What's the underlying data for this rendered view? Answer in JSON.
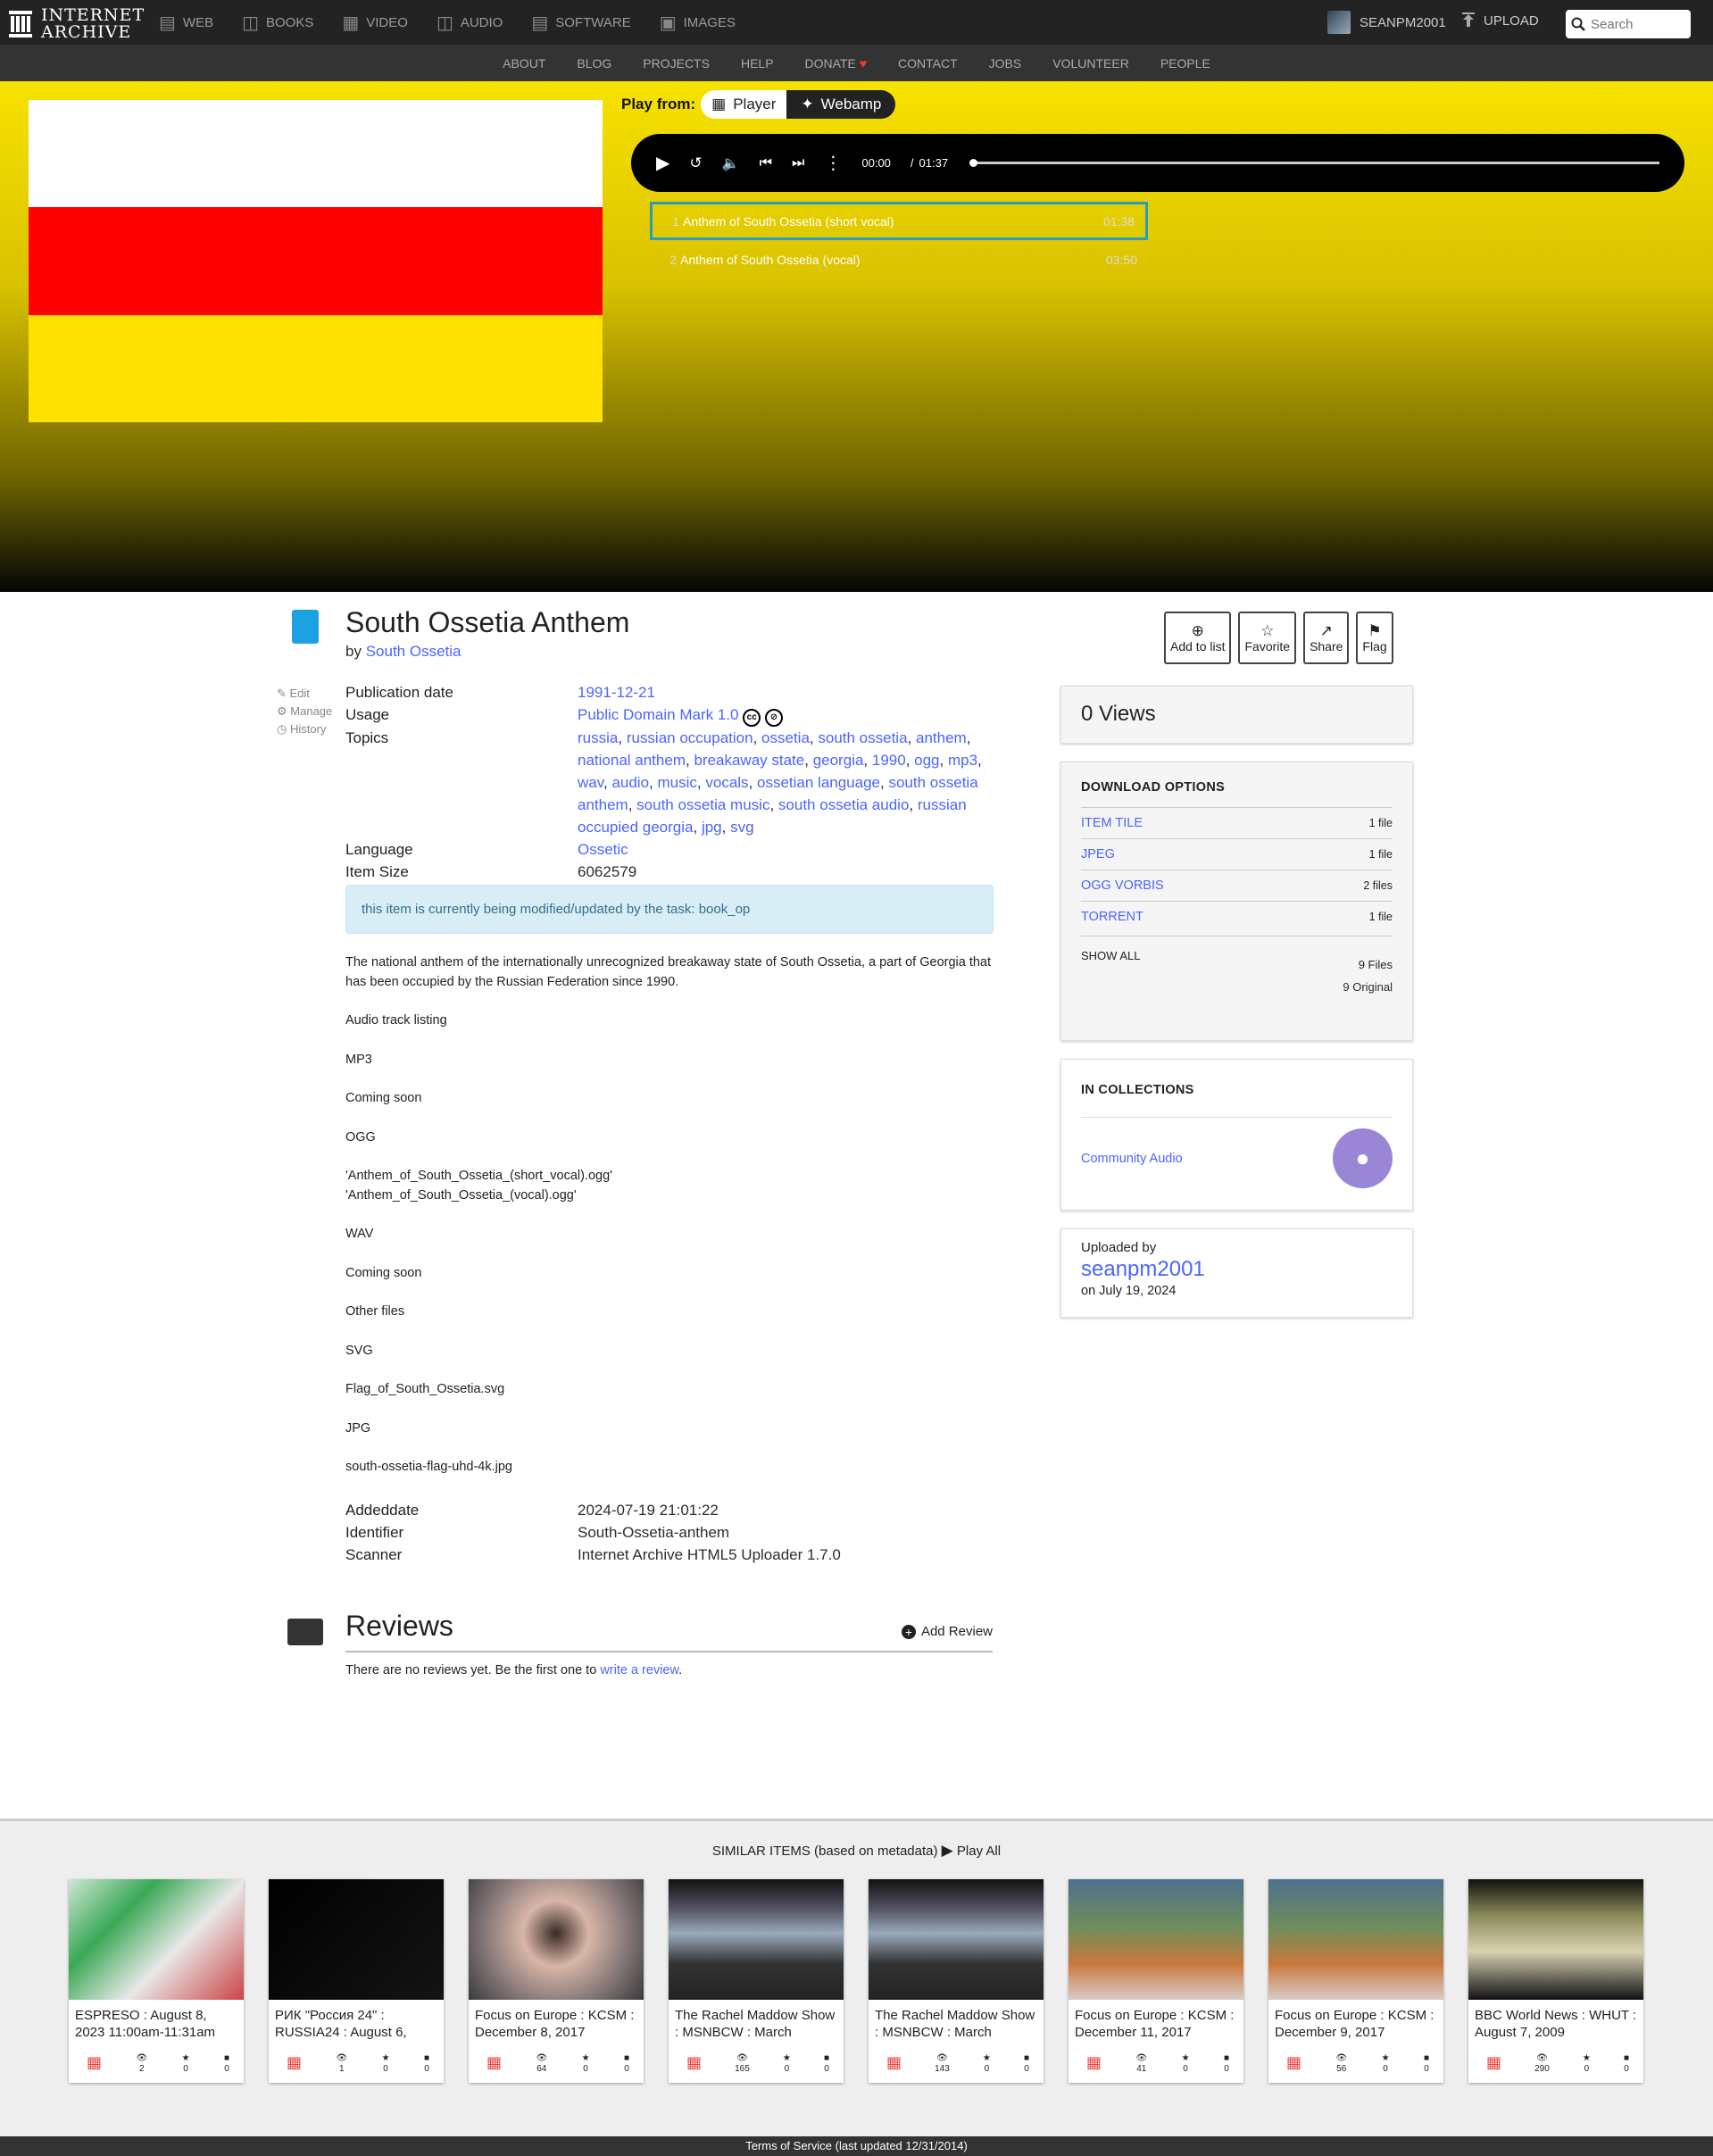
{
  "topnav": {
    "logo": "INTERNET ARCHIVE",
    "logo_line1": "INTERNET",
    "logo_line2": "ARCHIVE",
    "items": [
      {
        "label": "WEB",
        "icon": "web-icon"
      },
      {
        "label": "BOOKS",
        "icon": "books-icon"
      },
      {
        "label": "VIDEO",
        "icon": "video-icon"
      },
      {
        "label": "AUDIO",
        "icon": "audio-icon"
      },
      {
        "label": "SOFTWARE",
        "icon": "software-icon"
      },
      {
        "label": "IMAGES",
        "icon": "images-icon"
      }
    ],
    "username": "SEANPM2001",
    "upload": "UPLOAD",
    "search_placeholder": "Search"
  },
  "subnav": [
    "ABOUT",
    "BLOG",
    "PROJECTS",
    "HELP",
    "DONATE",
    "CONTACT",
    "JOBS",
    "VOLUNTEER",
    "PEOPLE"
  ],
  "flag_colors": [
    "#ffffff",
    "#ff0000",
    "#ffe000"
  ],
  "player": {
    "play_from": "Play from:",
    "mode_player": "Player",
    "mode_webamp": "Webamp",
    "current": "00:00",
    "sep": "/",
    "total": "01:37",
    "tracks": [
      {
        "num": "1",
        "title": "Anthem of South Ossetia (short vocal)",
        "dur": "01:38"
      },
      {
        "num": "2",
        "title": "Anthem of South Ossetia (vocal)",
        "dur": "03:50"
      }
    ]
  },
  "item": {
    "title": "South Ossetia Anthem",
    "by": "by",
    "creator": "South Ossetia",
    "actions": [
      {
        "label": "Add to list",
        "icon": "add-icon"
      },
      {
        "label": "Favorite",
        "icon": "star-icon"
      },
      {
        "label": "Share",
        "icon": "share-icon"
      },
      {
        "label": "Flag",
        "icon": "flag-icon"
      }
    ],
    "tools": [
      "Edit",
      "Manage",
      "History"
    ],
    "publication_date_label": "Publication date",
    "publication_date": "1991-12-21",
    "usage_label": "Usage",
    "usage": "Public Domain Mark 1.0",
    "topics_label": "Topics",
    "topics": [
      "russia",
      "russian occupation",
      "ossetia",
      "south ossetia",
      "anthem",
      "national anthem",
      "breakaway state",
      "georgia",
      "1990",
      "ogg",
      "mp3",
      "wav",
      "audio",
      "music",
      "vocals",
      "ossetian language",
      "south ossetia anthem",
      "south ossetia music",
      "south ossetia audio",
      "russian occupied georgia",
      "jpg",
      "svg"
    ],
    "language_label": "Language",
    "language": "Ossetic",
    "item_size_label": "Item Size",
    "item_size": "6062579",
    "notice": "this item is currently being modified/updated by the task: book_op",
    "description": [
      "The national anthem of the internationally unrecognized breakaway state of South Ossetia, a part of Georgia that has been occupied by the Russian Federation since 1990.",
      "Audio track listing",
      "MP3",
      "Coming soon",
      "OGG",
      "'Anthem_of_South_Ossetia_(short_vocal).ogg'\n'Anthem_of_South_Ossetia_(vocal).ogg'",
      "WAV",
      "Coming soon",
      "Other files",
      "SVG",
      "Flag_of_South_Ossetia.svg",
      "JPG",
      "south-ossetia-flag-uhd-4k.jpg"
    ],
    "addeddate_label": "Addeddate",
    "addeddate": "2024-07-19 21:01:22",
    "identifier_label": "Identifier",
    "identifier": "South-Ossetia-anthem",
    "scanner_label": "Scanner",
    "scanner": "Internet Archive HTML5 Uploader 1.7.0"
  },
  "reviews": {
    "title": "Reviews",
    "add": "Add Review",
    "empty_prefix": "There are no reviews yet. Be the first one to",
    "empty_link": "write a review",
    "empty_suffix": "."
  },
  "sidebar": {
    "views": "0 Views",
    "download_title": "DOWNLOAD OPTIONS",
    "downloads": [
      {
        "label": "ITEM TILE",
        "count": "1 file"
      },
      {
        "label": "JPEG",
        "count": "1 file"
      },
      {
        "label": "OGG VORBIS",
        "count": "2 files"
      },
      {
        "label": "TORRENT",
        "count": "1 file"
      }
    ],
    "show_all": "SHOW ALL",
    "files_total": "9 Files",
    "original_total": "9 Original",
    "collections_title": "IN COLLECTIONS",
    "collection": "Community Audio",
    "uploaded_by": "Uploaded by",
    "uploader": "seanpm2001",
    "upload_date": "on July 19, 2024"
  },
  "similar": {
    "heading": "SIMILAR ITEMS (based on metadata)",
    "play_all": "Play All",
    "items": [
      {
        "title": "ESPRESO : August 8, 2023 11:00am-11:31am",
        "views": "2",
        "favs": "0",
        "reviews": "0"
      },
      {
        "title": "РИК \"Россия 24\" : RUSSIA24 : August 6,",
        "views": "1",
        "favs": "0",
        "reviews": "0"
      },
      {
        "title": "Focus on Europe : KCSM : December 8, 2017",
        "views": "64",
        "favs": "0",
        "reviews": "0"
      },
      {
        "title": "The Rachel Maddow Show : MSNBCW : March",
        "views": "165",
        "favs": "0",
        "reviews": "0"
      },
      {
        "title": "The Rachel Maddow Show : MSNBCW : March",
        "views": "143",
        "favs": "0",
        "reviews": "0"
      },
      {
        "title": "Focus on Europe : KCSM : December 11, 2017",
        "views": "41",
        "favs": "0",
        "reviews": "0"
      },
      {
        "title": "Focus on Europe : KCSM : December 9, 2017",
        "views": "56",
        "favs": "0",
        "reviews": "0"
      },
      {
        "title": "BBC World News : WHUT : August 7, 2009",
        "views": "290",
        "favs": "0",
        "reviews": "0"
      }
    ]
  },
  "footer": "Terms of Service (last updated 12/31/2014)"
}
